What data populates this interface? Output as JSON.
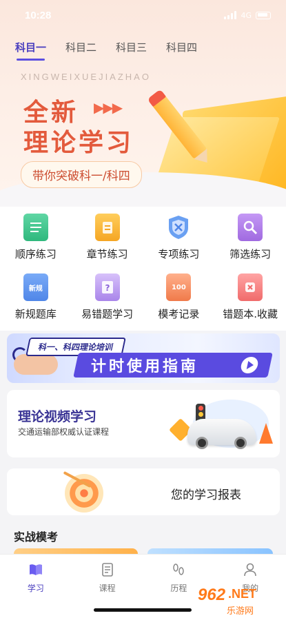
{
  "status_bar": {
    "time": "10:28",
    "network": "4G"
  },
  "tabs": [
    {
      "label": "科目一",
      "active": true
    },
    {
      "label": "科目二",
      "active": false
    },
    {
      "label": "科目三",
      "active": false
    },
    {
      "label": "科目四",
      "active": false
    }
  ],
  "hero": {
    "pinyin": "XINGWEIXUEJIAZHAO",
    "title_line1": "全新",
    "title_line2": "理论学习",
    "tagline": "带你突破科一/科四"
  },
  "features": [
    {
      "label": "顺序练习",
      "icon": "list-book-icon",
      "color": "#3cc08d"
    },
    {
      "label": "章节练习",
      "icon": "clipboard-icon",
      "color": "#f5a623"
    },
    {
      "label": "专项练习",
      "icon": "shield-icon",
      "color": "#4f86e8"
    },
    {
      "label": "筛选练习",
      "icon": "magnifier-icon",
      "color": "#a06ae0"
    },
    {
      "label": "新规题库",
      "icon": "new-book-icon",
      "color": "#4f86e8",
      "badge": "新规"
    },
    {
      "label": "易错题学习",
      "icon": "question-book-icon",
      "color": "#a06ae0"
    },
    {
      "label": "模考记录",
      "icon": "score-sheet-icon",
      "color": "#f07a4a",
      "badge": "100"
    },
    {
      "label": "错题本.收藏",
      "icon": "error-book-icon",
      "color": "#f06b6b"
    }
  ],
  "banner": {
    "tag": "科一、科四理论培训",
    "main": "计时使用指南"
  },
  "video_card": {
    "title": "理论视频学习",
    "subtitle": "交通运输部权威认证课程"
  },
  "report_card": {
    "label": "您的学习报表"
  },
  "section": {
    "title": "实战模考"
  },
  "bottom_nav": [
    {
      "label": "学习",
      "icon": "book-open-icon",
      "active": true
    },
    {
      "label": "课程",
      "icon": "document-icon",
      "active": false
    },
    {
      "label": "历程",
      "icon": "footprints-icon",
      "active": false
    },
    {
      "label": "我的",
      "icon": "user-icon",
      "active": false
    }
  ],
  "watermark": {
    "brand": "962",
    "domain": ".NET",
    "sub": "乐游网"
  },
  "colors": {
    "accent": "#5b4ee0",
    "hero_title": "#e35a3c"
  }
}
